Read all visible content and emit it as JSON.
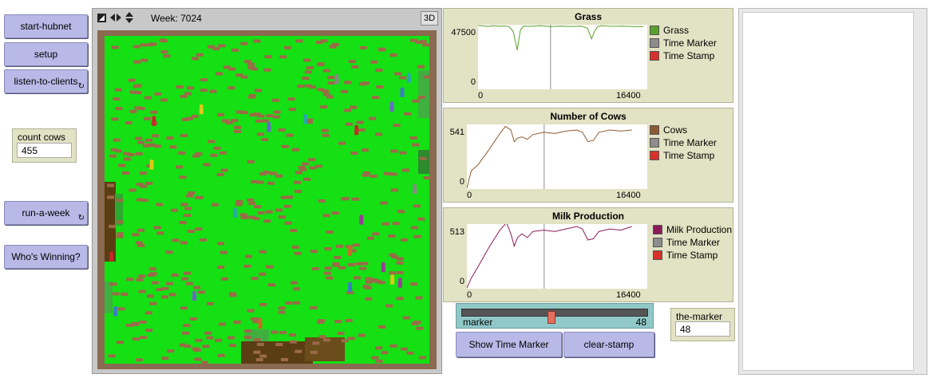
{
  "buttons": {
    "start_hubnet": "start-hubnet",
    "setup": "setup",
    "listen": "listen-to-clients",
    "run_week": "run-a-week",
    "whos_winning": "Who's Winning?",
    "show_time_marker": "Show Time Marker",
    "clear_stamp": "clear-stamp"
  },
  "monitors": {
    "count_cows": {
      "label": "count cows",
      "value": "455"
    },
    "the_marker": {
      "label": "the-marker",
      "value": "48"
    }
  },
  "view": {
    "tick_label": "Week: 7024",
    "three_d": "3D"
  },
  "slider": {
    "label": "marker",
    "value": "48",
    "min": 0,
    "max": 100
  },
  "colors": {
    "grass": "#5aa02c",
    "cows": "#8c5a32",
    "milk": "#8c1b5a",
    "time_marker": "#8d8d8d",
    "time_stamp": "#d73229"
  },
  "chart_data": [
    {
      "type": "line",
      "title": "Grass",
      "xlim": [
        0,
        16400
      ],
      "ylim": [
        0,
        47500
      ],
      "x_ticks": [
        "0",
        "16400"
      ],
      "y_ticks": [
        "47500",
        "0"
      ],
      "marker_x": 7024,
      "series": [
        {
          "name": "Grass",
          "x": [
            0,
            500,
            1000,
            1500,
            2000,
            2500,
            3000,
            3400,
            3800,
            4100,
            4400,
            5000,
            6000,
            7000,
            8000,
            9000,
            10000,
            10600,
            11000,
            11300,
            11600,
            12000,
            13000,
            14000,
            15000,
            16000
          ],
          "y": [
            47500,
            47200,
            46800,
            47400,
            46900,
            47200,
            46700,
            43000,
            29000,
            44000,
            47000,
            46900,
            47400,
            46800,
            47100,
            46700,
            47000,
            45500,
            37500,
            43500,
            46800,
            47300,
            46900,
            47000,
            46800,
            46600
          ]
        }
      ],
      "legend": [
        "Grass",
        "Time Marker",
        "Time Stamp"
      ]
    },
    {
      "type": "line",
      "title": "Number of Cows",
      "xlim": [
        0,
        16400
      ],
      "ylim": [
        0,
        541
      ],
      "x_ticks": [
        "0",
        "16400"
      ],
      "y_ticks": [
        "541",
        "0"
      ],
      "marker_x": 7024,
      "series": [
        {
          "name": "Cows",
          "x": [
            0,
            400,
            1000,
            2000,
            3000,
            3500,
            4000,
            4300,
            4600,
            5000,
            5500,
            6000,
            7000,
            8000,
            9000,
            10000,
            10500,
            11000,
            11500,
            12000,
            13000,
            14000,
            15000
          ],
          "y": [
            0,
            150,
            200,
            330,
            470,
            530,
            500,
            400,
            430,
            440,
            420,
            460,
            480,
            470,
            490,
            500,
            480,
            400,
            410,
            480,
            500,
            490,
            500
          ]
        }
      ],
      "legend": [
        "Cows",
        "Time Marker",
        "Time Stamp"
      ]
    },
    {
      "type": "line",
      "title": "Milk Production",
      "xlim": [
        0,
        16400
      ],
      "ylim": [
        0,
        513
      ],
      "x_ticks": [
        "0",
        "16400"
      ],
      "y_ticks": [
        "513",
        "0"
      ],
      "marker_x": 7024,
      "series": [
        {
          "name": "Milk Production",
          "x": [
            0,
            400,
            1000,
            2000,
            3000,
            3600,
            4000,
            4300,
            4600,
            5000,
            5500,
            6000,
            7000,
            8000,
            9000,
            10000,
            10500,
            11000,
            11500,
            12000,
            13000,
            14000,
            15000
          ],
          "y": [
            0,
            80,
            170,
            330,
            470,
            530,
            440,
            340,
            410,
            440,
            410,
            460,
            470,
            460,
            480,
            500,
            480,
            390,
            400,
            460,
            480,
            470,
            500
          ]
        }
      ],
      "legend": [
        "Milk Production",
        "Time Marker",
        "Time Stamp"
      ]
    }
  ]
}
